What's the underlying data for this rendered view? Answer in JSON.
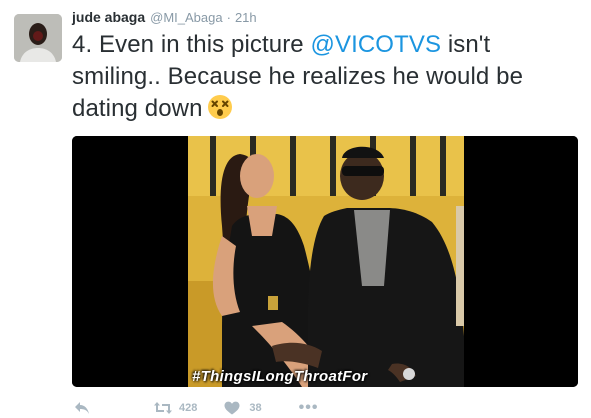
{
  "tweet": {
    "author": {
      "fullname": "jude abaga",
      "username": "@MI_Abaga",
      "separator": "·",
      "time": "21h"
    },
    "text": {
      "part1": "4. Even in this picture ",
      "mention": "@VICOTVS",
      "part2": " isn't smiling.. Because he realizes he would be dating down"
    },
    "emoji": "dizzy-face-emoji",
    "media": {
      "overlay_text": "#ThingsILongThroatFor"
    },
    "actions": {
      "retweet_count": "428",
      "like_count": "38",
      "more": "•••"
    }
  },
  "colors": {
    "accent": "#1b95e0",
    "text": "#292f33",
    "muted": "#8899a6",
    "action": "#aab8c2",
    "photo_bg": "#e2b83a"
  },
  "icons": [
    "reply-icon",
    "retweet-icon",
    "like-icon",
    "more-icon"
  ]
}
